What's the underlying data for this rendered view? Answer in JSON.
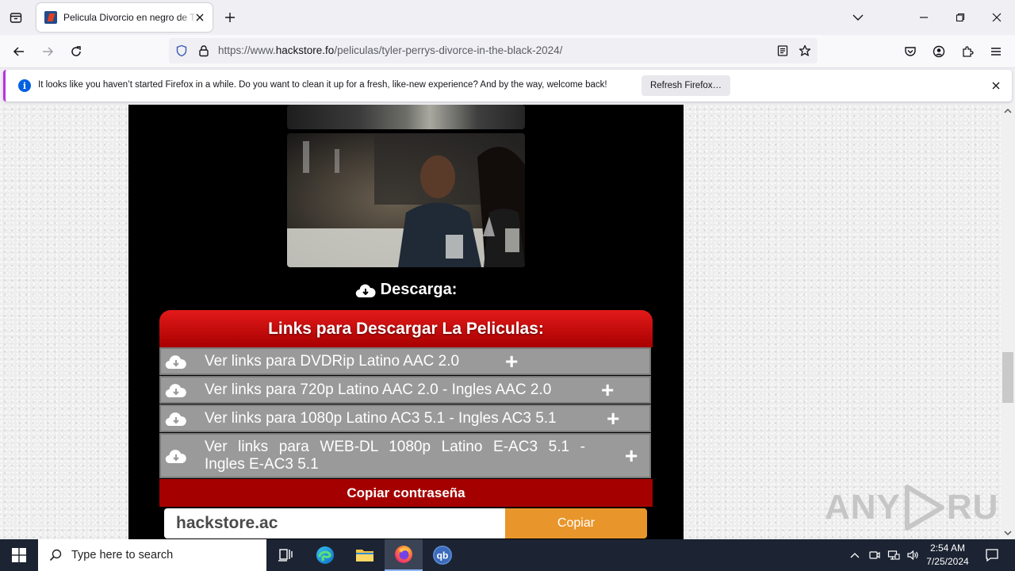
{
  "browser": {
    "tab_title": "Pelicula Divorcio en negro de Tyler Perry",
    "url_prefix": "https://www.",
    "url_domain": "hackstore.fo",
    "url_path": "/peliculas/tyler-perrys-divorce-in-the-black-2024/"
  },
  "notification": {
    "message": "It looks like you haven’t started Firefox in a while. Do you want to clean it up for a fresh, like-new experience? And by the way, welcome back!",
    "button_label": "Refresh Firefox…"
  },
  "page": {
    "download_heading": "Descarga:",
    "links_title": "Links para Descargar La Peliculas:",
    "links": [
      {
        "label_line1": "Ver links para DVDRip Latino AAC 2.0",
        "label_line2": ""
      },
      {
        "label_line1": "Ver links para 720p Latino AAC 2.0 - Ingles AAC 2.0",
        "label_line2": ""
      },
      {
        "label_line1": "Ver links para 1080p Latino AC3 5.1 - Ingles AC3 5.1",
        "label_line2": ""
      },
      {
        "label_line1": "Ver links para WEB-DL 1080p Latino E-AC3 5.1 -",
        "label_line2": "Ingles E-AC3 5.1"
      }
    ],
    "plus_symbol": "+",
    "copy_password_label": "Copiar contraseña",
    "password_value": "hackstore.ac",
    "copy_button_label": "Copiar"
  },
  "watermark": {
    "left": "ANY",
    "right": "RUN"
  },
  "taskbar": {
    "search_placeholder": "Type here to search",
    "time": "2:54 AM",
    "date": "7/25/2024"
  },
  "colors": {
    "accent_red": "#e31a1a",
    "dark_red": "#a50000",
    "copy_orange": "#e8962b",
    "taskbar": "#1c2433"
  }
}
